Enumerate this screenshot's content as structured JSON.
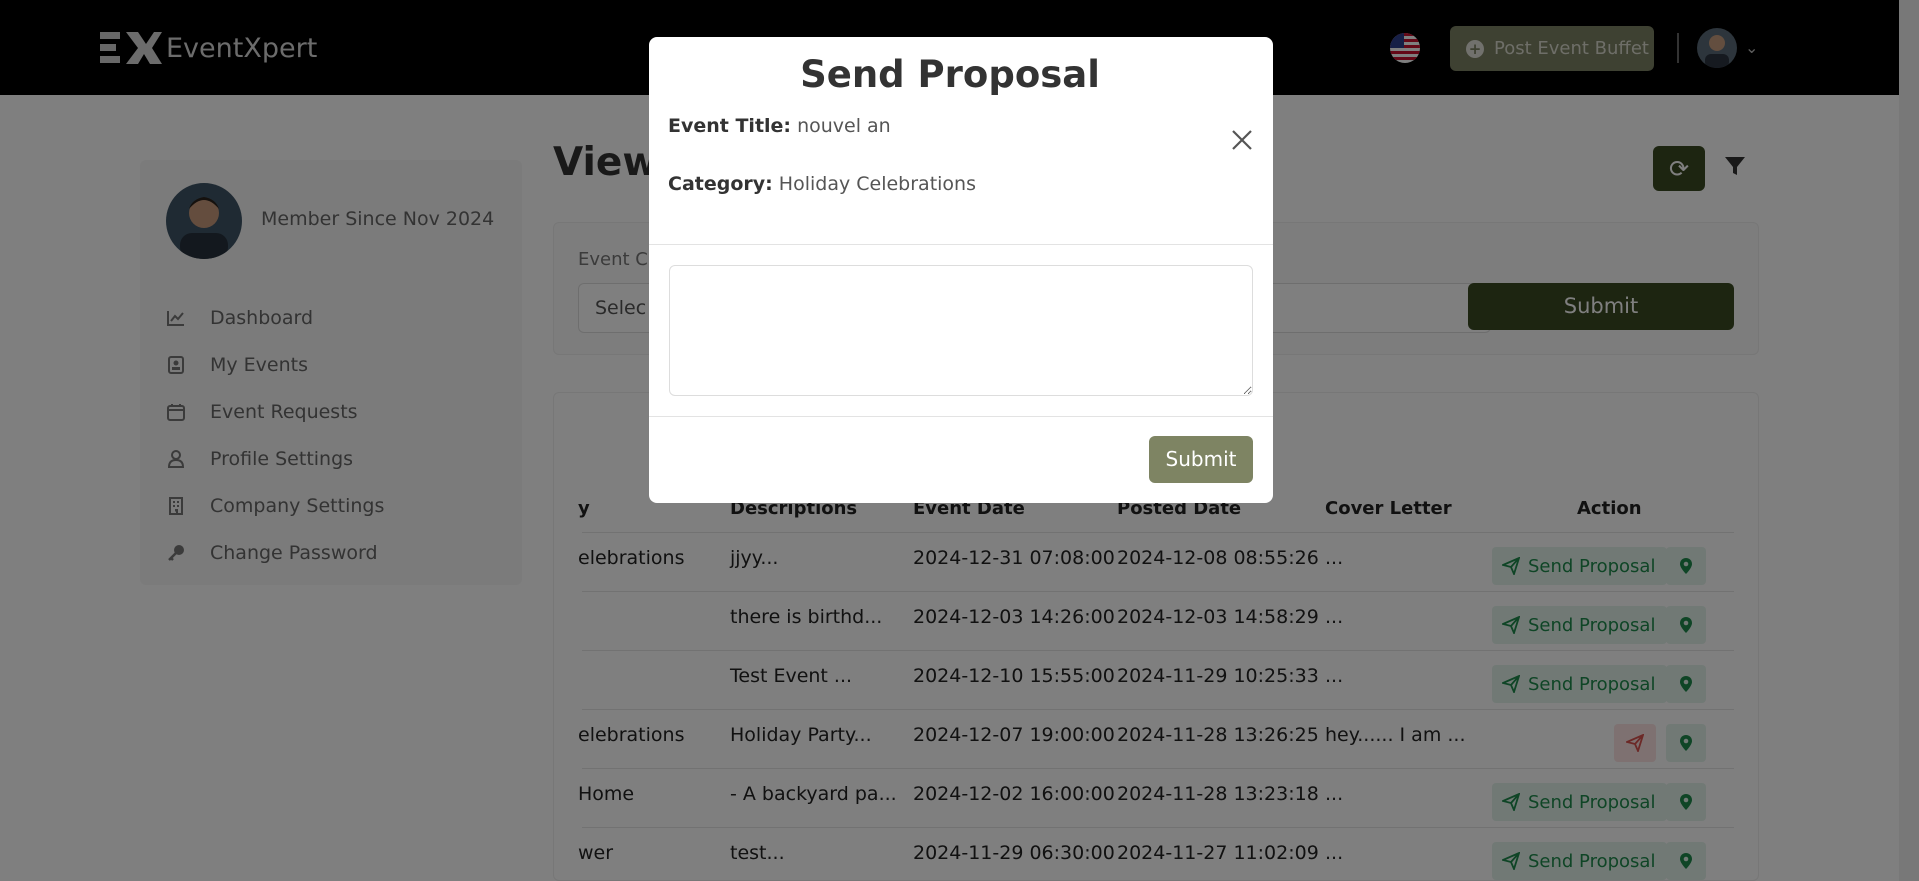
{
  "header": {
    "brand": "EventXpert",
    "post_button_label": "Post Event Buffet"
  },
  "sidebar": {
    "member_since": "Member Since Nov 2024",
    "items": [
      {
        "label": "Dashboard",
        "icon": "chart-line-icon"
      },
      {
        "label": "My Events",
        "icon": "id-badge-icon"
      },
      {
        "label": "Event Requests",
        "icon": "calendar-icon"
      },
      {
        "label": "Profile Settings",
        "icon": "user-icon"
      },
      {
        "label": "Company Settings",
        "icon": "building-icon"
      },
      {
        "label": "Change Password",
        "icon": "key-icon"
      }
    ]
  },
  "main": {
    "title": "View",
    "filter": {
      "category_label": "Event C",
      "category_select": "Selec",
      "submit_label": "Submit"
    },
    "table": {
      "columns": {
        "category": "y",
        "descriptions": "Descriptions",
        "event_date": "Event Date",
        "posted_date": "Posted Date",
        "cover_letter": "Cover Letter",
        "action": "Action"
      },
      "rows": [
        {
          "category": "elebrations",
          "description": "jjyy...",
          "event_date": "2024-12-31 07:08:00",
          "posted_date": "2024-12-08 08:55:26",
          "cover_letter": "...",
          "action": "Send Proposal"
        },
        {
          "category": "",
          "description": "there is birthd...",
          "event_date": "2024-12-03 14:26:00",
          "posted_date": "2024-12-03 14:58:29",
          "cover_letter": "...",
          "action": "Send Proposal"
        },
        {
          "category": "",
          "description": "Test Event ...",
          "event_date": "2024-12-10 15:55:00",
          "posted_date": "2024-11-29 10:25:33",
          "cover_letter": "...",
          "action": "Send Proposal"
        },
        {
          "category": "elebrations",
          "description": "Holiday Party...",
          "event_date": "2024-12-07 19:00:00",
          "posted_date": "2024-11-28 13:26:25",
          "cover_letter": "hey...... I am ...",
          "action": ""
        },
        {
          "category": "Home",
          "description": "- A backyard pa...",
          "event_date": "2024-12-02 16:00:00",
          "posted_date": "2024-11-28 13:23:18",
          "cover_letter": "...",
          "action": "Send Proposal"
        },
        {
          "category": "wer",
          "description": "test...",
          "event_date": "2024-11-29 06:30:00",
          "posted_date": "2024-11-27 11:02:09",
          "cover_letter": "...",
          "action": "Send Proposal"
        }
      ]
    }
  },
  "modal": {
    "title": "Send Proposal",
    "event_title_label": "Event Title:",
    "event_title_value": "nouvel an",
    "category_label": "Category:",
    "category_value": "Holiday Celebrations",
    "textarea_value": "",
    "submit_label": "Submit"
  },
  "colors": {
    "olive_primary": "#3b4a23",
    "olive_muted": "#7e8463",
    "success_green": "#1f8a4c",
    "danger_red": "#d9534f"
  }
}
